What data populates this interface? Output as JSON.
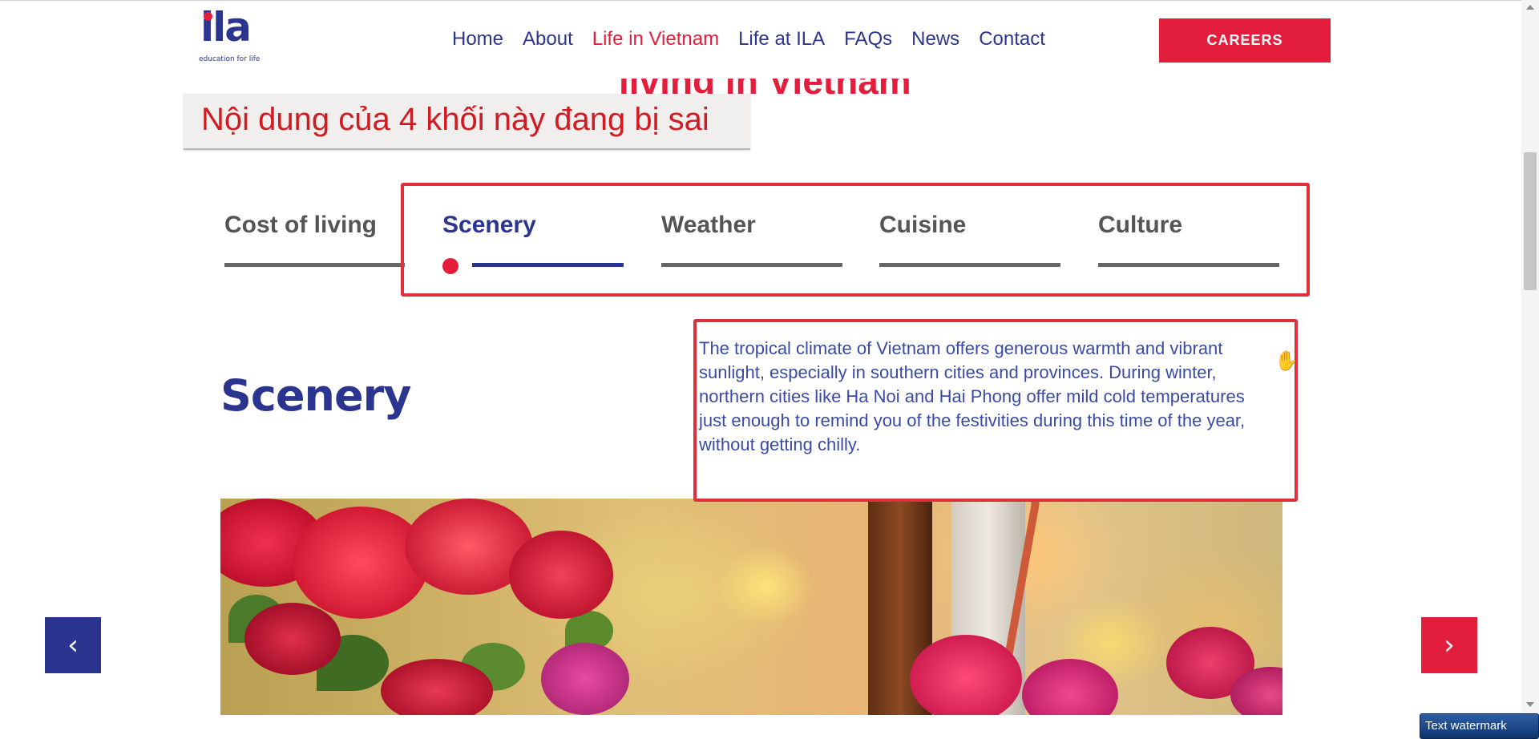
{
  "header": {
    "logo_text": "ila",
    "logo_tagline": "education for life",
    "nav": [
      {
        "label": "Home",
        "active": false
      },
      {
        "label": "About",
        "active": false
      },
      {
        "label": "Life in Vietnam",
        "active": true
      },
      {
        "label": "Life at ILA",
        "active": false
      },
      {
        "label": "FAQs",
        "active": false
      },
      {
        "label": "News",
        "active": false
      },
      {
        "label": "Contact",
        "active": false
      }
    ],
    "careers_label": "CAREERS"
  },
  "hidden_heading": "living in Vietnam",
  "annotation_note": "Nội dung của 4 khối này đang bị sai",
  "tabs": [
    {
      "label": "Cost of living",
      "active": false
    },
    {
      "label": "Scenery",
      "active": true
    },
    {
      "label": "Weather",
      "active": false
    },
    {
      "label": "Cuisine",
      "active": false
    },
    {
      "label": "Culture",
      "active": false
    }
  ],
  "section": {
    "title": "Scenery",
    "description": "The tropical climate of Vietnam offers generous warmth and vibrant sunlight, especially in southern cities and provinces. During winter, northern cities like Ha Noi and Hai Phong offer mild cold temperatures just enough to remind you of the festivities during this time of the year, without getting chilly."
  },
  "carousel": {
    "prev_icon": "chevron-left-icon",
    "next_icon": "chevron-right-icon",
    "prev_glyph": "‹",
    "next_glyph": "›"
  },
  "cursor_glyph": "✋",
  "watermark": "Text watermark",
  "colors": {
    "brand_blue": "#2b3590",
    "brand_red": "#e31d3c",
    "annotation_red": "#e0303a"
  }
}
